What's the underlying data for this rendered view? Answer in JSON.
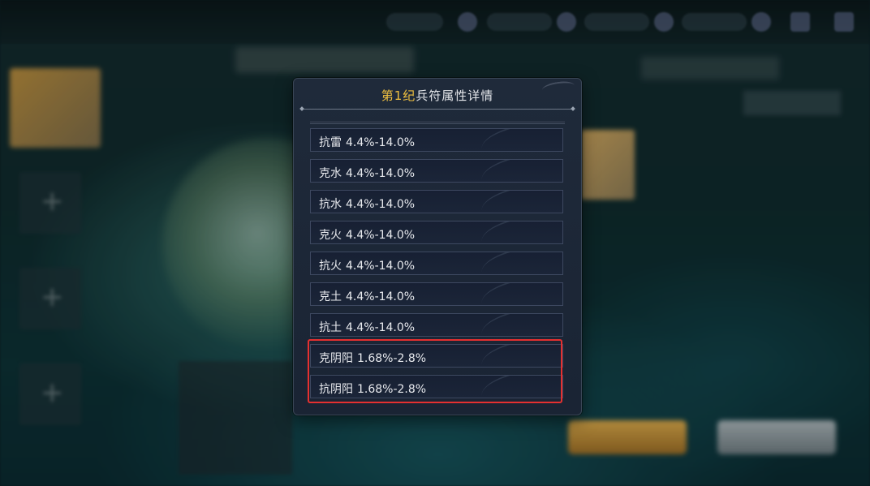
{
  "popup": {
    "title_era": "第1纪",
    "title_rest": "兵符属性详情"
  },
  "attributes": [
    {
      "name": "抗雷",
      "range": "4.4%-14.0%"
    },
    {
      "name": "克水",
      "range": "4.4%-14.0%"
    },
    {
      "name": "抗水",
      "range": "4.4%-14.0%"
    },
    {
      "name": "克火",
      "range": "4.4%-14.0%"
    },
    {
      "name": "抗火",
      "range": "4.4%-14.0%"
    },
    {
      "name": "克土",
      "range": "4.4%-14.0%"
    },
    {
      "name": "抗土",
      "range": "4.4%-14.0%"
    },
    {
      "name": "克阴阳",
      "range": "1.68%-2.8%"
    },
    {
      "name": "抗阴阳",
      "range": "1.68%-2.8%"
    }
  ],
  "colors": {
    "era_highlight": "#f0c040",
    "annotation_box": "#e53030"
  }
}
